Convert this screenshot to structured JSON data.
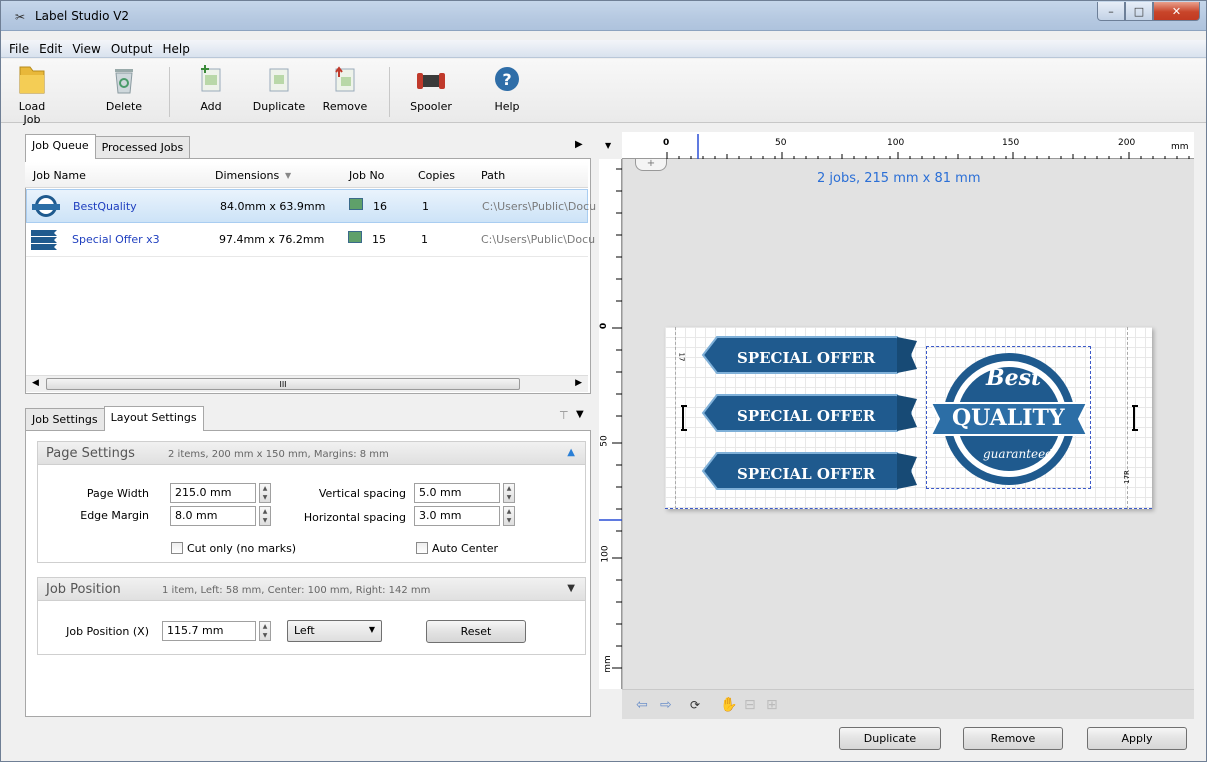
{
  "window": {
    "title": "Label Studio V2"
  },
  "menu": [
    "File",
    "Edit",
    "View",
    "Output",
    "Help"
  ],
  "toolbar": {
    "load_job": "Load Job",
    "delete": "Delete",
    "add": "Add",
    "duplicate": "Duplicate",
    "remove": "Remove",
    "spooler": "Spooler",
    "help": "Help"
  },
  "queue_tabs": {
    "job_queue": "Job Queue",
    "processed": "Processed Jobs"
  },
  "columns": {
    "name": "Job Name",
    "dimensions": "Dimensions",
    "job_no": "Job No",
    "copies": "Copies",
    "path": "Path"
  },
  "jobs": [
    {
      "name": "BestQuality",
      "dimensions": "84.0mm x 63.9mm",
      "job_no": "16",
      "copies": "1",
      "path": "C:\\Users\\Public\\Docu"
    },
    {
      "name": "Special Offer x3",
      "dimensions": "97.4mm x 76.2mm",
      "job_no": "15",
      "copies": "1",
      "path": "C:\\Users\\Public\\Docu"
    }
  ],
  "scroll_grip": "III",
  "settings_tabs": {
    "job": "Job Settings",
    "layout": "Layout Settings"
  },
  "page_settings": {
    "title": "Page Settings",
    "summary": "2 items,  200 mm x 150 mm,  Margins: 8 mm",
    "page_width_label": "Page Width",
    "page_width": "215.0 mm",
    "edge_margin_label": "Edge Margin",
    "edge_margin": "8.0 mm",
    "vertical_spacing_label": "Vertical spacing",
    "vertical_spacing": "5.0 mm",
    "horizontal_spacing_label": "Horizontal spacing",
    "horizontal_spacing": "3.0 mm",
    "cut_only": "Cut only (no marks)",
    "auto_center": "Auto Center"
  },
  "job_position": {
    "title": "Job Position",
    "summary": "1 item, Left: 58 mm, Center: 100 mm, Right: 142 mm",
    "label": "Job Position (X)",
    "value": "115.7 mm",
    "align": "Left",
    "reset": "Reset"
  },
  "preview": {
    "summary": "2 jobs,  215 mm x 81 mm",
    "ruler_unit": "mm",
    "h_ticks": [
      "0",
      "50",
      "100",
      "150",
      "200"
    ],
    "v_ticks": [
      "0",
      "50",
      "100"
    ],
    "label_left": "17",
    "label_right": "17R",
    "offer_text": "SPECIAL OFFER",
    "badge_best": "Best",
    "badge_quality": "QUALITY",
    "badge_guaranteed": "guaranteed"
  },
  "footer": {
    "duplicate": "Duplicate",
    "remove": "Remove",
    "apply": "Apply"
  },
  "colors": {
    "label_blue": "#1f5a8e",
    "accent": "#2b6fd6"
  }
}
